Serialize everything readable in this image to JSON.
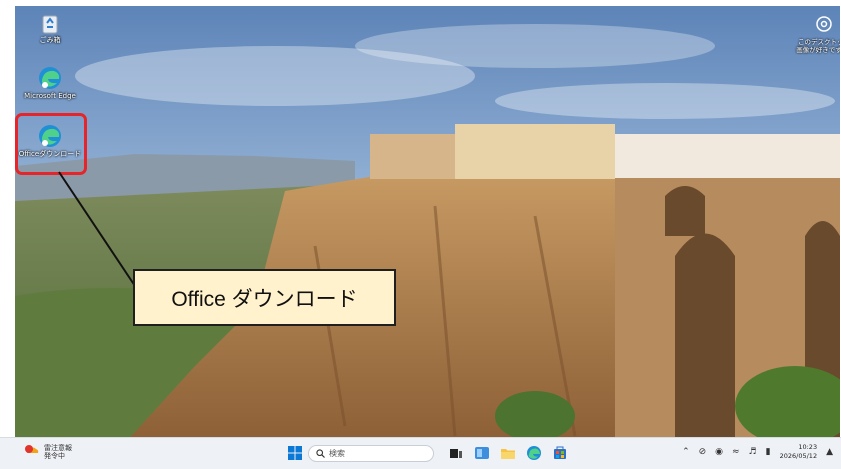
{
  "desktop": {
    "icons": [
      {
        "label": "ごみ箱"
      },
      {
        "label": "Microsoft Edge"
      },
      {
        "label": "Officeダウンロード"
      }
    ],
    "top_right_icon": {
      "label": "このデスクトップ画像が好きですか?"
    }
  },
  "callout": {
    "text": "Office ダウンロード"
  },
  "taskbar": {
    "weather": {
      "line1": "雷注意報",
      "line2": "発令中"
    },
    "search_placeholder": "検索",
    "clock": {
      "time": "10:23",
      "date": "2026/05/12"
    }
  },
  "colors": {
    "highlight": "#e5252a",
    "callout_bg": "#fff2cc"
  }
}
